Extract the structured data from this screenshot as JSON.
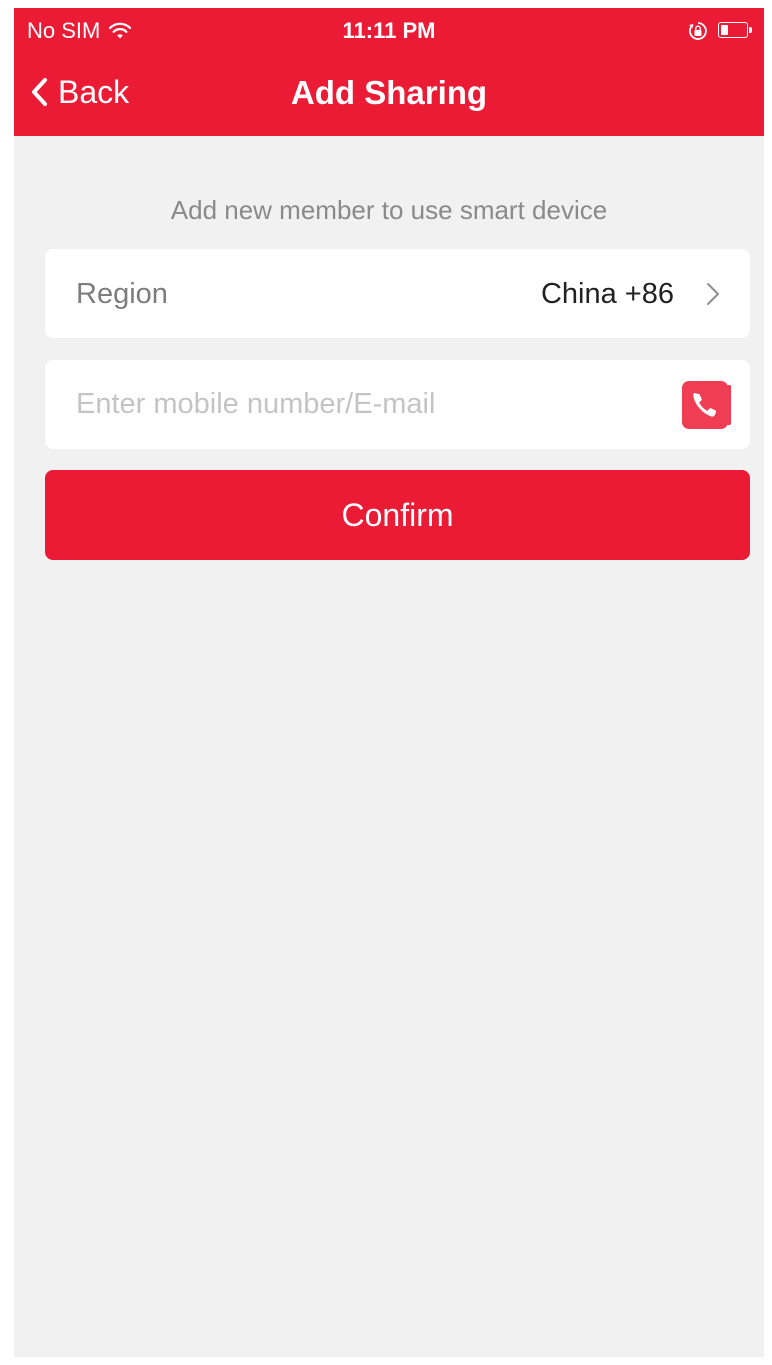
{
  "status_bar": {
    "carrier": "No SIM",
    "time": "11:11 PM",
    "wifi_icon": "wifi-icon",
    "lock_icon": "orientation-lock-icon",
    "battery_icon": "battery-icon",
    "battery_level": 0.3
  },
  "nav": {
    "back_label": "Back",
    "back_icon": "chevron-left-icon",
    "title": "Add Sharing"
  },
  "content": {
    "subtitle": "Add new member to use smart device",
    "region": {
      "label": "Region",
      "value": "China +86",
      "icon": "chevron-right-icon"
    },
    "contact": {
      "value": "",
      "placeholder": "Enter mobile number/E-mail",
      "icon": "contacts-phone-icon"
    },
    "confirm_label": "Confirm"
  },
  "colors": {
    "accent": "#ec1b35",
    "background": "#f1f1f1",
    "card": "#ffffff",
    "contacts_icon": "#ef3e53"
  }
}
